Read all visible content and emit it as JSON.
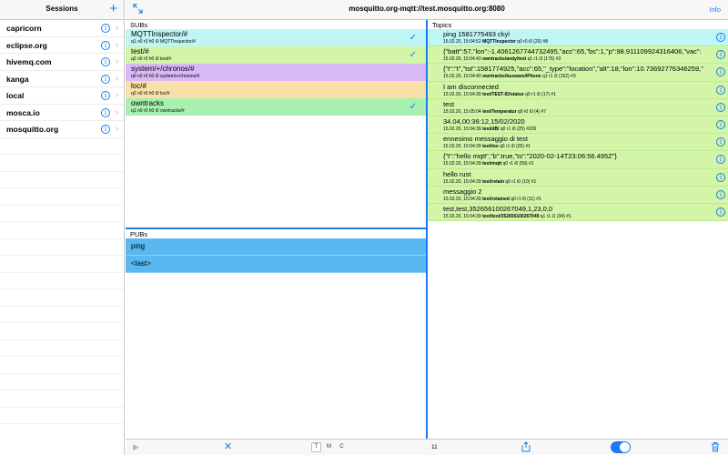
{
  "sidebar": {
    "title": "Sessions",
    "add_label": "+",
    "sessions": [
      {
        "label": "capricorn"
      },
      {
        "label": "eclipse.org"
      },
      {
        "label": "hivemq.com"
      },
      {
        "label": "kanga"
      },
      {
        "label": "local"
      },
      {
        "label": "mosca.io"
      },
      {
        "label": "mosquitto.org"
      }
    ]
  },
  "header": {
    "title": "mosquitto.org-mqtt://test.mosquitto.org:8080",
    "info_label": "Info"
  },
  "subs": {
    "title": "SUBs",
    "items": [
      {
        "topic": "MQTTInspector/#",
        "meta": "q1 n0 r0 h0 i0 MQTTInspector/#",
        "color": "#bff5f5",
        "checked": true
      },
      {
        "topic": "test/#",
        "meta": "q2 n0 r0 h0 i0 test/#",
        "color": "#d2f5a8",
        "checked": true
      },
      {
        "topic": "system/+/chronos/#",
        "meta": "q0 n0 r0 h0 i0 system/+/chronos/#",
        "color": "#d8b8f5",
        "checked": false
      },
      {
        "topic": "loc/#",
        "meta": "q2 n0 r0 h0 i0 loc/#",
        "color": "#f9dfa8",
        "checked": false
      },
      {
        "topic": "owntracks",
        "meta": "q1 n0 r0 h0 i0 owntracks/#",
        "color": "#a8f0b0",
        "checked": true
      }
    ]
  },
  "pubs": {
    "title": "PUBs",
    "items": [
      {
        "label": "ping"
      },
      {
        "label": "<last>"
      }
    ]
  },
  "topics": {
    "title": "Topics",
    "items": [
      {
        "payload": "ping 1581775493 ckyl",
        "meta_time": "15.02.20, 15:04:52",
        "meta_topic": "MQTTInspector",
        "meta_rest": "q0 r0 i0 (20) #8",
        "highlight": true
      },
      {
        "payload": "{\"batt\":57,\"lon\":-1.4061267744732495,\"acc\":65,\"bs\":1,\"p\":98.911109924316406,\"vac\":",
        "meta_time": "15.02.20, 15:04:43",
        "meta_topic": "owntracks/andy/test",
        "meta_rest": "q1 r1 i3 (176) #3",
        "highlight": false
      },
      {
        "payload": "{\"t\":\"t\",\"tst\":1581774925,\"acc\":65,\"_type\":\"location\",\"alt\":18,\"lon\":10.73692776346259,\"",
        "meta_time": "15.02.20, 15:04:43",
        "meta_topic": "owntracks/busware/iPhone",
        "meta_rest": "q1 r1 i2 (152) #3",
        "highlight": false
      },
      {
        "payload": "I am disconnected",
        "meta_time": "15.02.20, 15:04:39",
        "meta_topic": "test/TEST-ID/status",
        "meta_rest": "q0 r1 i0 (17) #1",
        "highlight": false
      },
      {
        "payload": "test",
        "meta_time": "15.02.20, 15:05:04",
        "meta_topic": "test/Temperatur",
        "meta_rest": "q0 r0 i0 (4) #7",
        "highlight": false
      },
      {
        "payload": "34.04,00:36:12,15/02/2020",
        "meta_time": "15.02.20, 15:04:39",
        "meta_topic": "test/dB/",
        "meta_rest": "q0 r1 i0 (25) #226",
        "highlight": false
      },
      {
        "payload": "ennesimo messaggio di test",
        "meta_time": "15.02.20, 15:04:39",
        "meta_topic": "test/ios",
        "meta_rest": "q0 r1 i0 (26) #1",
        "highlight": false
      },
      {
        "payload": "{\"t\":\"hello mqtt\",\"b\":true,\"ts\":\"2020-02-14T23:06:56.495Z\"}",
        "meta_time": "15.02.20, 15:04:39",
        "meta_topic": "test/mqtt",
        "meta_rest": "q0 r1 i0 (59) #1",
        "highlight": false
      },
      {
        "payload": "hello rust",
        "meta_time": "15.02.20, 15:04:39",
        "meta_topic": "test/retain",
        "meta_rest": "q0 r1 i0 (10) #1",
        "highlight": false
      },
      {
        "payload": "messaggio 2",
        "meta_time": "15.02.20, 15:04:39",
        "meta_topic": "test/retained",
        "meta_rest": "q0 r1 i0 (11) #1",
        "highlight": false
      },
      {
        "payload": "test,test,352656100267049,1,23,0,0",
        "meta_time": "15.02.20, 15:04:39",
        "meta_topic": "test/test/352656100267049",
        "meta_rest": "q1 r1 i1 (34) #1",
        "highlight": false
      }
    ]
  },
  "toolbar": {
    "play_icon": "play-icon",
    "clear_icon": "x-icon",
    "modes": [
      "T",
      "M",
      "C"
    ],
    "active_mode": "T",
    "count": "11",
    "toggle_on": true
  },
  "colors": {
    "accent": "#1a7bf2",
    "topic_bg": "#d2f5a8",
    "topic_highlight": "#bff5f5",
    "pub_bg": "#5ab8f0"
  }
}
